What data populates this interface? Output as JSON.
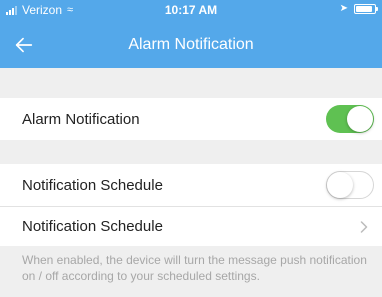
{
  "status_bar": {
    "carrier": "Verizon",
    "time": "10:17 AM",
    "battery_level": 0.9
  },
  "nav": {
    "title": "Alarm Notification",
    "back_icon": "arrow-left-icon"
  },
  "rows": [
    {
      "label": "Alarm Notification",
      "toggle": true
    },
    {
      "label": "Notification Schedule",
      "toggle": false
    },
    {
      "label": "Notification Schedule",
      "chevron_icon": "chevron-right-icon"
    }
  ],
  "footer_note": "When enabled, the device will turn the message push notification on / off according to your scheduled settings.",
  "colors": {
    "header": "#54a8ea",
    "toggle_on": "#5fc152",
    "background": "#efefef"
  }
}
